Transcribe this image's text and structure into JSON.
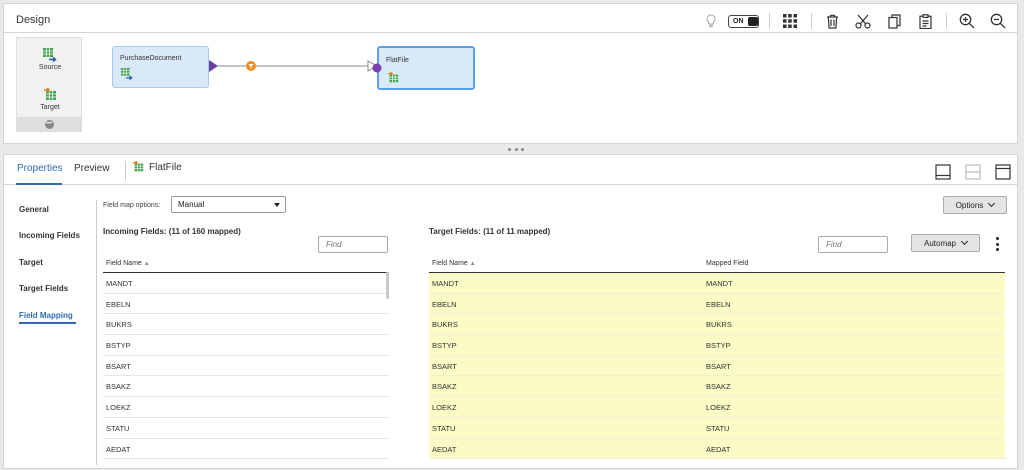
{
  "design": {
    "title": "Design",
    "toggle_label": "ON",
    "toolbar_icons": [
      "lightbulb-icon",
      "toggle-switch",
      "grid-icon",
      "trash-icon",
      "scissors-icon",
      "copy-icon",
      "paste-icon",
      "zoom-in-icon",
      "zoom-out-icon"
    ]
  },
  "palette": {
    "items": [
      {
        "label": "Source",
        "icon": "source-icon"
      },
      {
        "label": "Target",
        "icon": "target-icon"
      }
    ],
    "more_icon": "more-icon"
  },
  "canvas": {
    "source_node": {
      "label": "PurchaseDocument"
    },
    "target_node": {
      "label": "FlatFile"
    },
    "link_icon": "link-filter-icon"
  },
  "properties": {
    "tabs": [
      {
        "label": "Properties",
        "active": true
      },
      {
        "label": "Preview",
        "active": false
      }
    ],
    "object_label": "FlatFile",
    "layout_icons": [
      "dock-bottom-icon",
      "split-view-icon",
      "dock-top-icon"
    ]
  },
  "sidenav": {
    "items": [
      {
        "label": "General",
        "active": false
      },
      {
        "label": "Incoming Fields",
        "active": false
      },
      {
        "label": "Target",
        "active": false
      },
      {
        "label": "Target Fields",
        "active": false
      },
      {
        "label": "Field Mapping",
        "active": true
      }
    ]
  },
  "mapping": {
    "field_map_label": "Field map options:",
    "field_map_value": "Manual",
    "options_label": "Options",
    "incoming": {
      "title": "Incoming Fields: (11 of 160 mapped)",
      "find_placeholder": "Find",
      "col_field": "Field Name",
      "rows": [
        "MANDT",
        "EBELN",
        "BUKRS",
        "BSTYP",
        "BSART",
        "BSAKZ",
        "LOEKZ",
        "STATU",
        "AEDAT"
      ]
    },
    "target": {
      "title": "Target Fields: (11 of 11 mapped)",
      "find_placeholder": "Find",
      "automap_label": "Automap",
      "col_field": "Field Name",
      "col_mapped": "Mapped Field",
      "rows": [
        {
          "field": "MANDT",
          "mapped": "MANDT"
        },
        {
          "field": "EBELN",
          "mapped": "EBELN"
        },
        {
          "field": "BUKRS",
          "mapped": "BUKRS"
        },
        {
          "field": "BSTYP",
          "mapped": "BSTYP"
        },
        {
          "field": "BSART",
          "mapped": "BSART"
        },
        {
          "field": "BSAKZ",
          "mapped": "BSAKZ"
        },
        {
          "field": "LOEKZ",
          "mapped": "LOEKZ"
        },
        {
          "field": "STATU",
          "mapped": "STATU"
        },
        {
          "field": "AEDAT",
          "mapped": "AEDAT"
        }
      ]
    }
  },
  "colors": {
    "accent": "#2d6cb5",
    "node_fill": "#d9e9f9",
    "mapped_row": "#fbfbc6",
    "link_purple": "#6b3fa0",
    "link_orange": "#f28c1e"
  }
}
